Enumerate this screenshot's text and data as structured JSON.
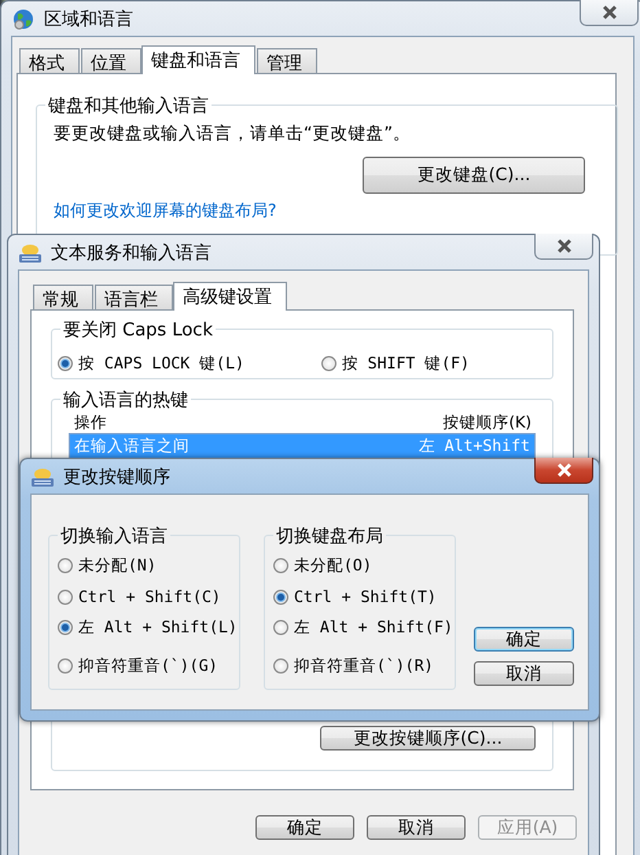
{
  "region_window": {
    "title": "区域和语言",
    "tabs": [
      {
        "label": "格式",
        "selected": false
      },
      {
        "label": "位置",
        "selected": false
      },
      {
        "label": "键盘和语言",
        "selected": true
      },
      {
        "label": "管理",
        "selected": false
      }
    ],
    "keyboard_group": {
      "title": "键盘和其他输入语言",
      "text": "要更改键盘或输入语言，请单击“更改键盘”。",
      "button": "更改键盘(C)...",
      "link": "如何更改欢迎屏幕的键盘布局?"
    }
  },
  "text_services_window": {
    "title": "文本服务和输入语言",
    "tabs": [
      {
        "label": "常规",
        "selected": false
      },
      {
        "label": "语言栏",
        "selected": false
      },
      {
        "label": "高级键设置",
        "selected": true
      }
    ],
    "caps_lock": {
      "title": "要关闭 Caps Lock",
      "options": [
        {
          "label": "按 CAPS LOCK 键(L)",
          "selected": true
        },
        {
          "label": "按 SHIFT 键(F)",
          "selected": false
        }
      ]
    },
    "hotkeys": {
      "title": "输入语言的热键",
      "columns": [
        "操作",
        "按键顺序(K)"
      ],
      "rows": [
        {
          "action": "在输入语言之间",
          "keys": "左 Alt+Shift",
          "selected": true
        }
      ],
      "button": "更改按键顺序(C)..."
    },
    "buttons": [
      {
        "label": "确定",
        "disabled": false
      },
      {
        "label": "取消",
        "disabled": false
      },
      {
        "label": "应用(A)",
        "disabled": true
      }
    ]
  },
  "key_sequence_dialog": {
    "title": "更改按键顺序",
    "groups": [
      {
        "title": "切换输入语言",
        "options": [
          {
            "label": "未分配(N)",
            "selected": false
          },
          {
            "label": "Ctrl + Shift(C)",
            "selected": false
          },
          {
            "label": "左 Alt + Shift(L)",
            "selected": true
          },
          {
            "label": "抑音符重音(`)(G)",
            "selected": false
          }
        ]
      },
      {
        "title": "切换键盘布局",
        "options": [
          {
            "label": "未分配(O)",
            "selected": false
          },
          {
            "label": "Ctrl + Shift(T)",
            "selected": true
          },
          {
            "label": "左 Alt + Shift(F)",
            "selected": false
          },
          {
            "label": "抑音符重音(`)(R)",
            "selected": false
          }
        ]
      }
    ],
    "buttons": [
      {
        "label": "确定",
        "default": true
      },
      {
        "label": "取消",
        "default": false
      }
    ]
  }
}
